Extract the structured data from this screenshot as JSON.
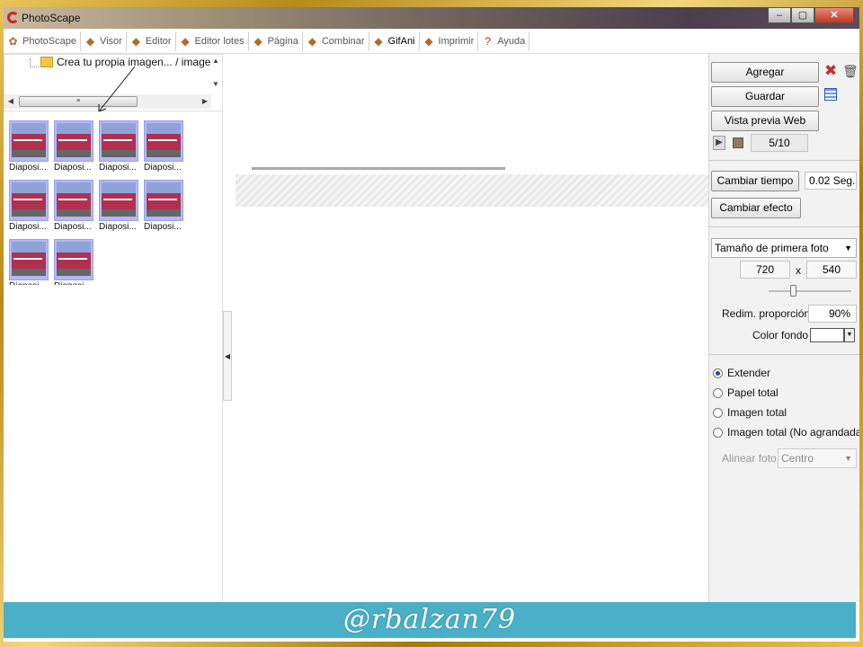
{
  "window": {
    "title": "PhotoScape",
    "minimize": "–",
    "maximize": "▢",
    "close": "✕"
  },
  "tabs": [
    {
      "label": "PhotoScape",
      "icon": "photoscape-icon",
      "glyph": "✿",
      "active": false
    },
    {
      "label": "Visor",
      "icon": "viewer-icon",
      "glyph": "◆",
      "active": false
    },
    {
      "label": "Editor",
      "icon": "editor-icon",
      "glyph": "◆",
      "active": false
    },
    {
      "label": "Editor lotes",
      "icon": "batch-editor-icon",
      "glyph": "◆",
      "active": false
    },
    {
      "label": "Página",
      "icon": "page-icon",
      "glyph": "◆",
      "active": false
    },
    {
      "label": "Combinar",
      "icon": "combine-icon",
      "glyph": "◆",
      "active": false
    },
    {
      "label": "GifAni",
      "icon": "gifani-icon",
      "glyph": "◆",
      "active": true
    },
    {
      "label": "Imprimir",
      "icon": "print-icon",
      "glyph": "◆",
      "active": false
    },
    {
      "label": "Ayuda",
      "icon": "help-icon",
      "glyph": "?",
      "active": false
    }
  ],
  "tree": {
    "item_label": "Crea tu propia imagen... / image"
  },
  "thumbnails": {
    "items": [
      {
        "label": "Diaposi..."
      },
      {
        "label": "Diaposi..."
      },
      {
        "label": "Diaposi..."
      },
      {
        "label": "Diaposi..."
      },
      {
        "label": "Diaposi..."
      },
      {
        "label": "Diaposi..."
      },
      {
        "label": "Diaposi..."
      },
      {
        "label": "Diaposi..."
      },
      {
        "label": "Diaposi..."
      },
      {
        "label": "Diaposi..."
      }
    ]
  },
  "right_panel": {
    "add_label": "Agregar",
    "save_label": "Guardar",
    "web_preview_label": "Vista previa Web",
    "frame_counter": "5/10",
    "change_time_label": "Cambiar tiempo",
    "time_value": "0.02 Seg.",
    "change_effect_label": "Cambiar efecto",
    "size_select": "Tamaño de primera foto",
    "width": "720",
    "times": "x",
    "height": "540",
    "resize_label": "Redim. proporción",
    "resize_value": "90%",
    "bg_color_label": "Color fondo",
    "options": [
      {
        "label": "Extender",
        "selected": true
      },
      {
        "label": "Papel total",
        "selected": false
      },
      {
        "label": "Imagen total",
        "selected": false
      },
      {
        "label": "Imagen total (No agrandada)",
        "selected": false
      }
    ],
    "align_label": "Alinear foto",
    "align_value": "Centro"
  },
  "footer": {
    "watermark": "@rbalzan79"
  }
}
